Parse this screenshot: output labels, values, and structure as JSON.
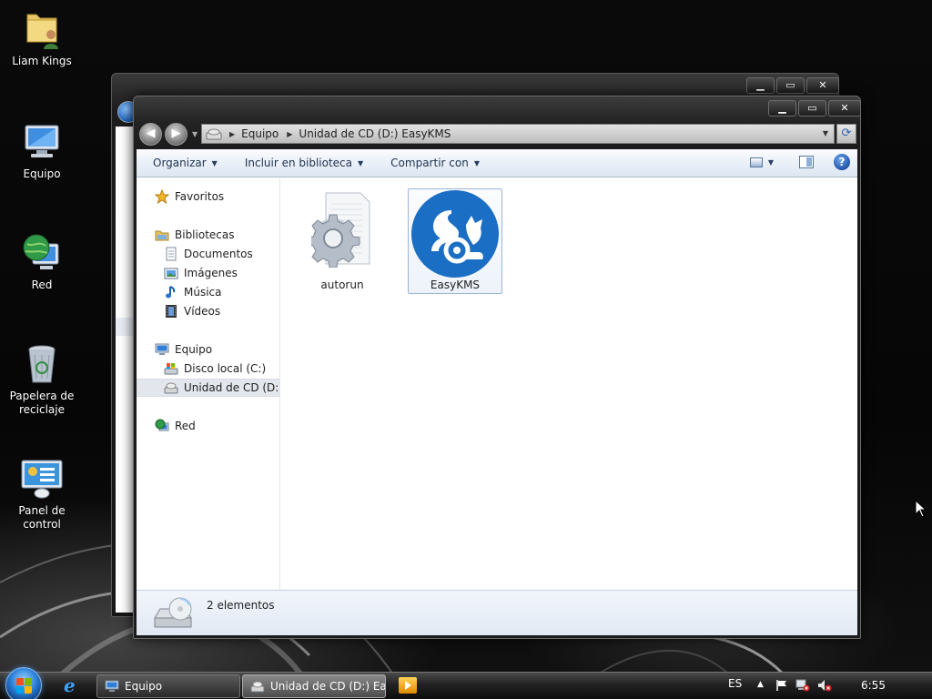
{
  "desktop": {
    "icons": [
      {
        "label": "Liam Kings",
        "icon": "user-folder-icon"
      },
      {
        "label": "Equipo",
        "icon": "computer-icon"
      },
      {
        "label": "Red",
        "icon": "network-globe-icon"
      },
      {
        "label": "Papelera de reciclaje",
        "icon": "recycle-bin-icon"
      },
      {
        "label": "Panel de control",
        "icon": "control-panel-icon"
      }
    ]
  },
  "back_window": {
    "caption": {
      "minimize": "▁",
      "maximize": "▭",
      "close": "✕"
    }
  },
  "explorer": {
    "caption": {
      "minimize": "▁",
      "maximize": "▭",
      "close": "✕"
    },
    "nav": {
      "back": "◀",
      "forward": "▶"
    },
    "address": {
      "crumbs": [
        "Equipo",
        "Unidad de CD (D:) EasyKMS"
      ]
    },
    "toolbar": {
      "organize": "Organizar",
      "include_library": "Incluir en biblioteca",
      "share_with": "Compartir con",
      "help": "?"
    },
    "nav_pane": {
      "favorites": "Favoritos",
      "libraries": "Bibliotecas",
      "library_items": [
        "Documentos",
        "Imágenes",
        "Música",
        "Vídeos"
      ],
      "computer": "Equipo",
      "computer_items": [
        "Disco local (C:)",
        "Unidad de CD (D:) Ea"
      ],
      "network": "Red"
    },
    "files": [
      {
        "name": "autorun",
        "icon": "settings-file-icon",
        "selected": false
      },
      {
        "name": "EasyKMS",
        "icon": "easykms-app-icon",
        "selected": true
      }
    ],
    "status": {
      "item_count": "2 elementos"
    }
  },
  "taskbar": {
    "buttons": [
      {
        "label": "Equipo",
        "icon": "computer-icon"
      },
      {
        "label": "Unidad de CD (D:) Ea...",
        "icon": "cd-drive-icon"
      }
    ],
    "tray": {
      "language": "ES",
      "show_hidden": "▲",
      "clock": "6:55"
    }
  },
  "colors": {
    "accent": "#1a6ec4",
    "easykms_blue": "#1a6ec4",
    "toolbar_text": "#1e3250"
  }
}
